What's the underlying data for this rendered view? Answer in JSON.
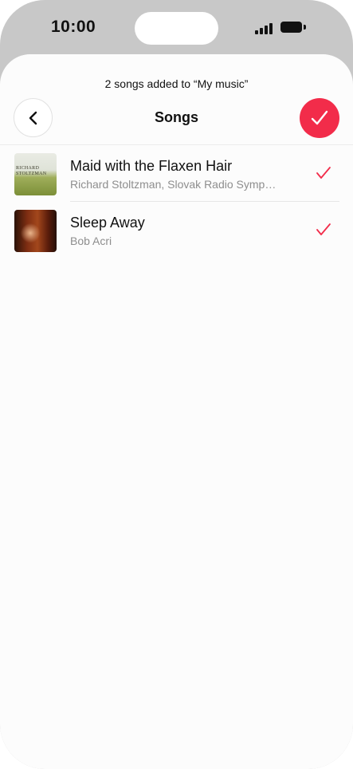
{
  "status_bar": {
    "time": "10:00"
  },
  "banner": "2 songs added to “My music”",
  "header": {
    "title": "Songs",
    "back_icon": "chevron-left-icon",
    "done_icon": "checkmark-icon"
  },
  "songs": [
    {
      "title": "Maid with the Flaxen Hair",
      "artist": "Richard Stoltzman, Slovak Radio Symp…",
      "selected": true,
      "art_text": "RICHARD STOLTZMAN"
    },
    {
      "title": "Sleep Away",
      "artist": "Bob Acri",
      "selected": true
    }
  ],
  "colors": {
    "accent": "#f22c4a",
    "sheet": "#fcfcfc",
    "device": "#c8c8c8"
  }
}
